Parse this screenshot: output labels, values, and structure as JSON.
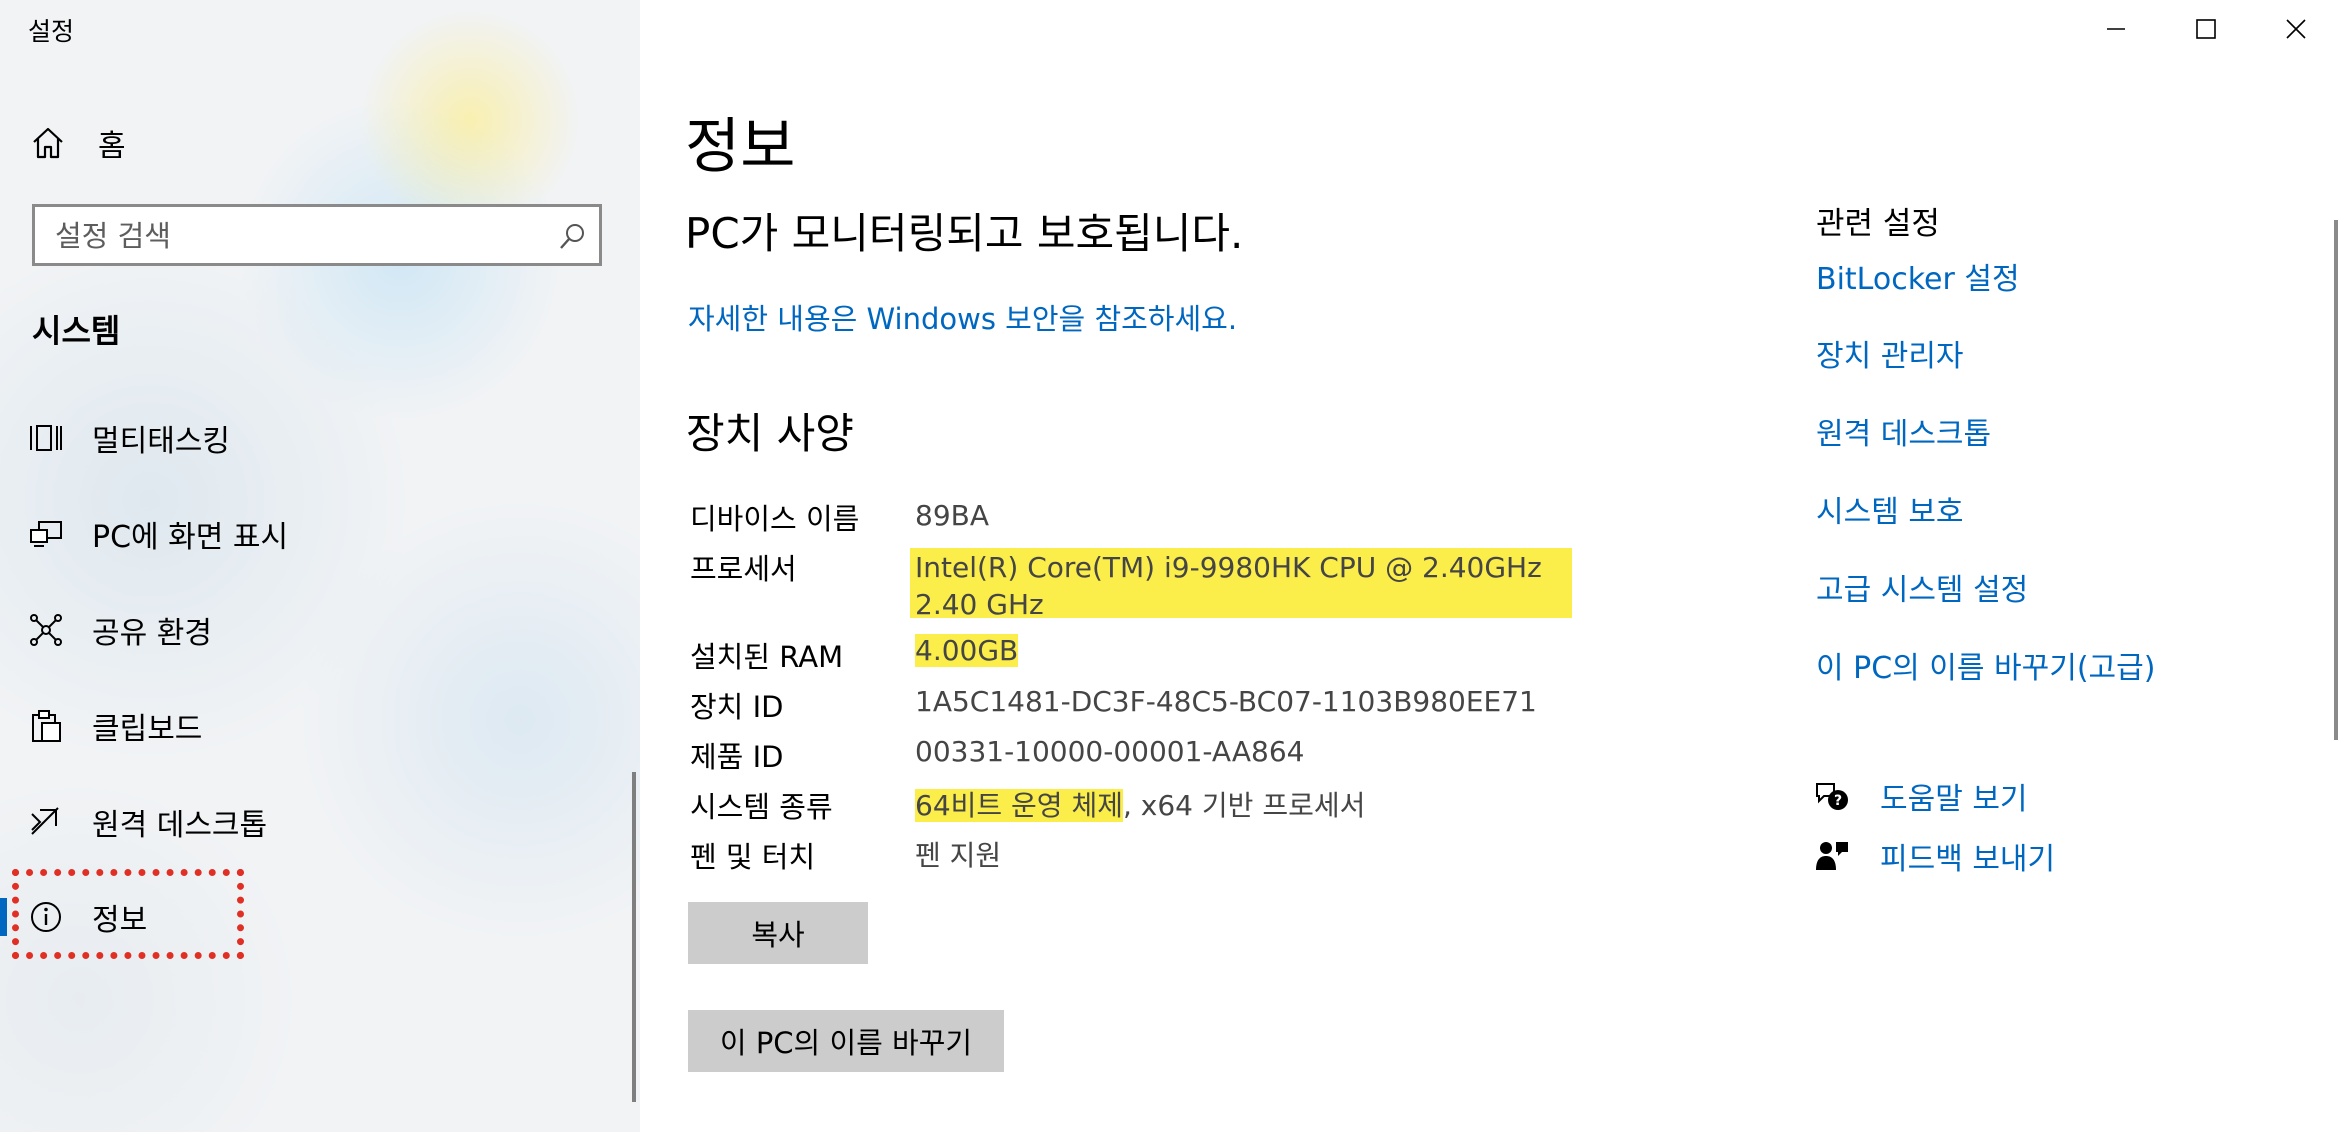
{
  "window": {
    "title": "설정",
    "controls": [
      "minimize-icon",
      "maximize-icon",
      "close-icon"
    ]
  },
  "sidebar": {
    "home_label": "홈",
    "search_placeholder": "설정 검색",
    "section_title": "시스템",
    "items": [
      {
        "label": "멀티태스킹",
        "icon": "multitasking-icon"
      },
      {
        "label": "PC에 화면 표시",
        "icon": "project-icon"
      },
      {
        "label": "공유 환경",
        "icon": "shared-experiences-icon"
      },
      {
        "label": "클립보드",
        "icon": "clipboard-icon"
      },
      {
        "label": "원격 데스크톱",
        "icon": "remote-desktop-icon"
      },
      {
        "label": "정보",
        "icon": "info-icon",
        "selected": true
      }
    ]
  },
  "main": {
    "page_title": "정보",
    "protection_title": "PC가 모니터링되고 보호됩니다.",
    "security_link": "자세한 내용은 Windows 보안을 참조하세요.",
    "specs_title": "장치 사양",
    "specs": {
      "device_name": {
        "label": "디바이스 이름",
        "value": "89BA"
      },
      "processor": {
        "label": "프로세서",
        "value": "Intel(R) Core(TM) i9-9980HK CPU @ 2.40GHz   2.40 GHz"
      },
      "ram": {
        "label": "설치된 RAM",
        "value": "4.00GB"
      },
      "device_id": {
        "label": "장치 ID",
        "value": "1A5C1481-DC3F-48C5-BC07-1103B980EE71"
      },
      "product_id": {
        "label": "제품 ID",
        "value": "00331-10000-00001-AA864"
      },
      "system_type": {
        "label": "시스템 종류",
        "value_highlight": "64비트 운영 체제",
        "value_rest": ", x64 기반 프로세서"
      },
      "pen_touch": {
        "label": "펜 및 터치",
        "value": "펜 지원"
      }
    },
    "copy_button": "복사",
    "rename_button": "이 PC의 이름 바꾸기"
  },
  "related": {
    "heading": "관련 설정",
    "links": [
      "BitLocker 설정",
      "장치 관리자",
      "원격 데스크톱",
      "시스템 보호",
      "고급 시스템 설정",
      "이 PC의 이름 바꾸기(고급)"
    ],
    "help_label": "도움말 보기",
    "feedback_label": "피드백 보내기"
  },
  "colors": {
    "accent": "#0067c0",
    "highlight": "#fbed4a",
    "annotation": "#e03025",
    "button_bg": "#cccccc"
  }
}
